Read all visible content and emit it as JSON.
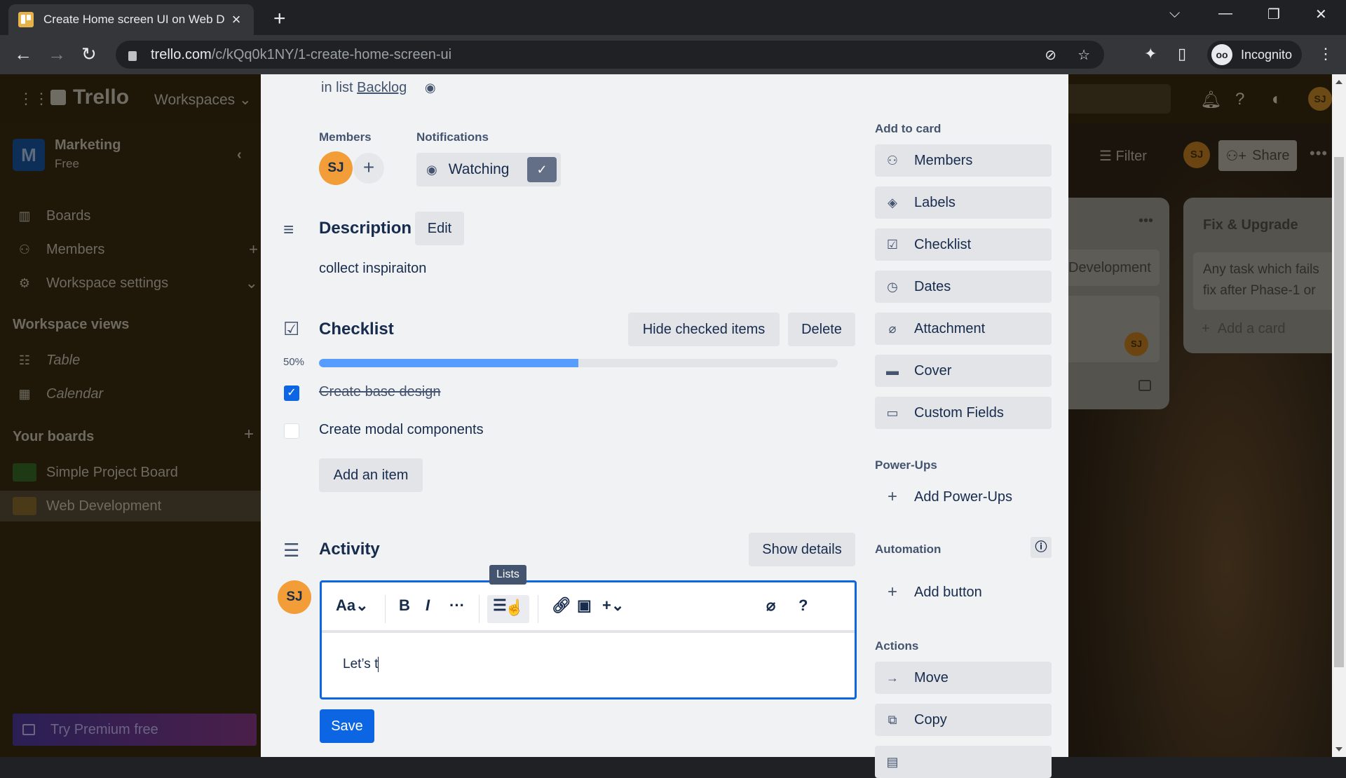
{
  "browser": {
    "tab_title": "Create Home screen UI on Web D",
    "new_tab_icon": "plus-icon",
    "url_host": "trello.com",
    "url_path": "/c/kQq0k1NY/1-create-home-screen-ui",
    "profile_label": "Incognito",
    "window_controls": [
      "chevron-down-icon",
      "minimize-icon",
      "restore-icon",
      "close-icon"
    ]
  },
  "trello_header": {
    "logo": "Trello",
    "workspaces_label": "Workspaces"
  },
  "sidebar": {
    "workspace_initial": "M",
    "workspace_name": "Marketing",
    "workspace_plan": "Free",
    "items": [
      {
        "label": "Boards",
        "icon": "board-icon"
      },
      {
        "label": "Members",
        "icon": "person-icon"
      },
      {
        "label": "Workspace settings",
        "icon": "gear-icon"
      }
    ],
    "views_heading": "Workspace views",
    "views": [
      {
        "label": "Table",
        "icon": "table-icon"
      },
      {
        "label": "Calendar",
        "icon": "calendar-icon"
      }
    ],
    "boards_heading": "Your boards",
    "boards": [
      {
        "label": "Simple Project Board",
        "thumb_color": "#1e3a14",
        "active": false
      },
      {
        "label": "Web Development",
        "thumb_color": "#4a3a18",
        "active": true
      }
    ],
    "premium_label": "Try Premium free"
  },
  "board": {
    "filter_label": "Filter",
    "member_initials": "SJ",
    "share_label": "Share",
    "list_a_card_text": "Development",
    "list_a_card_avatar": "SJ",
    "list_b_title": "Fix & Upgrade",
    "list_b_card_line1": "Any task which fails",
    "list_b_card_line2": "fix after Phase-1 or",
    "list_b_add": "Add a card"
  },
  "card": {
    "in_list_prefix": "in list",
    "list_name": "Backlog",
    "members_label": "Members",
    "member_initials": "SJ",
    "notifications_label": "Notifications",
    "watching_label": "Watching",
    "description": {
      "title": "Description",
      "edit_label": "Edit",
      "text": "collect inspiraiton"
    },
    "checklist": {
      "title": "Checklist",
      "hide_label": "Hide checked items",
      "delete_label": "Delete",
      "progress_label": "50%",
      "progress_percent": 50,
      "items": [
        {
          "text": "Create base design",
          "checked": true
        },
        {
          "text": "Create modal components",
          "checked": false
        }
      ],
      "add_item_label": "Add an item"
    },
    "activity": {
      "title": "Activity",
      "show_details_label": "Show details",
      "commenter_initials": "SJ",
      "editor": {
        "text_style": "Aa",
        "tooltip": "Lists",
        "content": "Let’s t",
        "save_label": "Save"
      }
    },
    "sidebar": {
      "add_to_card_label": "Add to card",
      "add_to_card": [
        {
          "label": "Members",
          "icon": "person-icon"
        },
        {
          "label": "Labels",
          "icon": "tag-icon"
        },
        {
          "label": "Checklist",
          "icon": "checklist-icon"
        },
        {
          "label": "Dates",
          "icon": "clock-icon"
        },
        {
          "label": "Attachment",
          "icon": "paperclip-icon"
        },
        {
          "label": "Cover",
          "icon": "cover-icon"
        },
        {
          "label": "Custom Fields",
          "icon": "custom-fields-icon"
        }
      ],
      "powerups_label": "Power-Ups",
      "add_powerups_label": "Add Power-Ups",
      "automation_label": "Automation",
      "add_button_label": "Add button",
      "actions_label": "Actions",
      "actions": [
        {
          "label": "Move",
          "icon": "arrow-right-icon"
        },
        {
          "label": "Copy",
          "icon": "copy-icon"
        }
      ]
    }
  }
}
